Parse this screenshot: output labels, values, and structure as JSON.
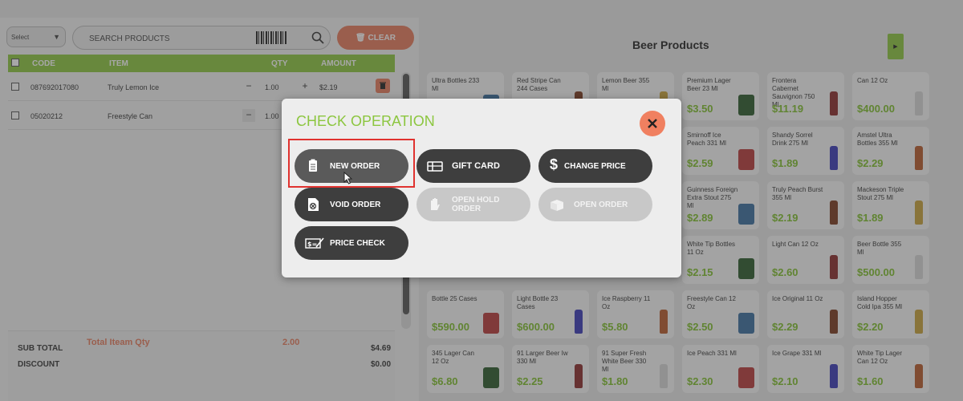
{
  "left_panel": {
    "select_label": "Select",
    "search_placeholder": "SEARCH PRODUCTS",
    "clear_label": "CLEAR",
    "columns": {
      "code": "CODE",
      "item": "ITEM",
      "qty": "QTY",
      "amount": "AMOUNT"
    },
    "rows": [
      {
        "code": "087692017080",
        "item": "Truly Lemon Ice",
        "qty": "1.00",
        "amount": "$2.19"
      },
      {
        "code": "05020212",
        "item": "Freestyle Can",
        "qty": "1.00",
        "amount": ""
      }
    ],
    "totals": {
      "sub_total_label": "SUB TOTAL",
      "sub_total_value": "$4.69",
      "discount_label": "DISCOUNT",
      "discount_value": "$0.00",
      "total_item_qty_label": "Total Iteam Qty",
      "total_item_qty_value": "2.00"
    }
  },
  "right_panel": {
    "title": "Beer Products",
    "products": [
      {
        "name": "Ultra Bottles 233 Ml",
        "price": ""
      },
      {
        "name": "Red Stripe Can 244 Cases",
        "price": ""
      },
      {
        "name": "Lemon Beer 355 Ml",
        "price": ""
      },
      {
        "name": "Premium Lager Beer 23 Ml",
        "price": "$3.50"
      },
      {
        "name": "Frontera Cabernet Sauvignon 750 Ml",
        "price": "$11.19"
      },
      {
        "name": "Can 12 Oz",
        "price": "$400.00"
      },
      {
        "name": "Smirnoff Ice Peach 331 Ml",
        "price": "$2.59"
      },
      {
        "name": "Shandy Sorrel Drink 275 Ml",
        "price": "$1.89"
      },
      {
        "name": "Amstel Ultra Bottles 355 Ml",
        "price": "$2.29"
      },
      {
        "name": "Guinness Foreign Extra Stout 275 Ml",
        "price": "$2.89"
      },
      {
        "name": "Truly Peach Burst 355 Ml",
        "price": "$2.19"
      },
      {
        "name": "Mackeson Triple Stout 275 Ml",
        "price": "$1.89"
      },
      {
        "name": "White Tip Bottles 11 Oz",
        "price": "$2.15"
      },
      {
        "name": "Light Can 12 Oz",
        "price": "$2.60"
      },
      {
        "name": "Beer Bottle 355 Ml",
        "price": "$500.00"
      },
      {
        "name": "Bottle 25 Cases",
        "price": "$590.00"
      },
      {
        "name": "Light Bottle 23 Cases",
        "price": "$600.00"
      },
      {
        "name": "Ice Raspberry 11 Oz",
        "price": "$5.80"
      },
      {
        "name": "Freestyle Can 12 Oz",
        "price": "$2.50"
      },
      {
        "name": "Ice Original 11 Oz",
        "price": "$2.29"
      },
      {
        "name": "Island Hopper Cold Ipa 355 Ml",
        "price": "$2.20"
      },
      {
        "name": "345 Lager Can 12 Oz",
        "price": "$6.80"
      },
      {
        "name": "91 Larger Beer Iw 330 Ml",
        "price": "$2.25"
      },
      {
        "name": "91 Super Fresh White Beer 330 Ml",
        "price": "$1.80"
      },
      {
        "name": "Ice Peach 331 Ml",
        "price": "$2.30"
      },
      {
        "name": "Ice Grape 331 Ml",
        "price": "$2.10"
      },
      {
        "name": "White Tip Lager Can 12 Oz",
        "price": "$1.60"
      }
    ]
  },
  "modal": {
    "title": "CHECK OPERATION",
    "buttons": {
      "new_order": "NEW ORDER",
      "gift_card": "GIFT CARD",
      "change_price": "CHANGE PRICE",
      "void_order": "VOID ORDER",
      "open_hold_order": "OPEN HOLD ORDER",
      "open_order": "OPEN ORDER",
      "price_check": "PRICE CHECK"
    }
  },
  "colors": {
    "accent_green": "#8cc63f",
    "accent_orange": "#e77b5c",
    "dark_button": "#3e3e3e",
    "highlight_red": "#e0322f"
  }
}
